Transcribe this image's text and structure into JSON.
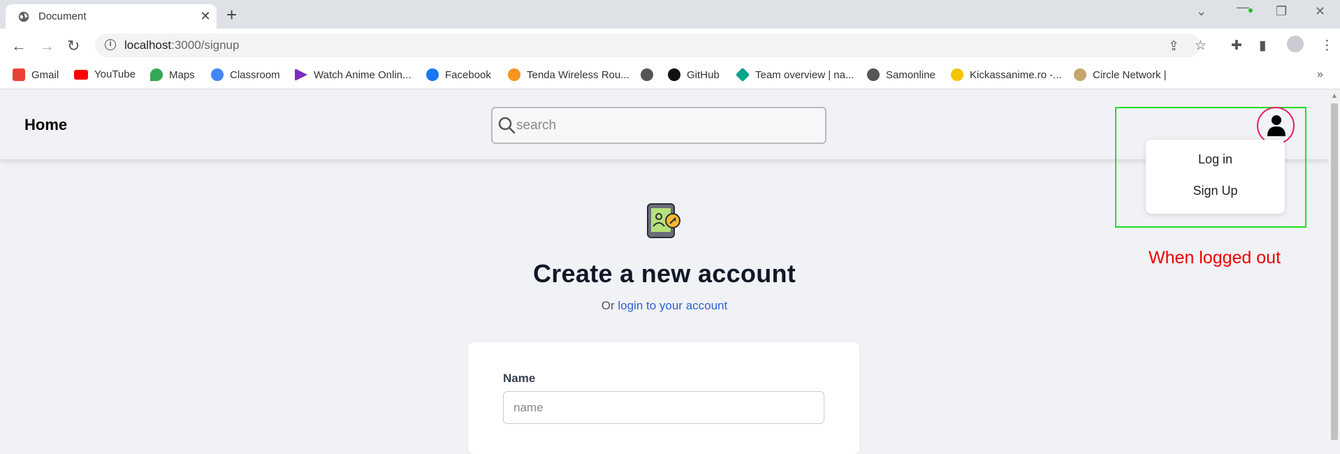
{
  "browser": {
    "tab_title": "Document",
    "url_host": "localhost",
    "url_path": ":3000/signup",
    "bookmarks": [
      {
        "label": "Gmail",
        "color": "#ea4335"
      },
      {
        "label": "YouTube",
        "color": "#ff0000"
      },
      {
        "label": "Maps",
        "color": "#34a853"
      },
      {
        "label": "Classroom",
        "color": "#4285f4"
      },
      {
        "label": "Watch Anime Onlin...",
        "color": "#7b2cbf"
      },
      {
        "label": "Facebook",
        "color": "#1877f2"
      },
      {
        "label": "Tenda Wireless Rou...",
        "color": "#f7931e"
      },
      {
        "label": "",
        "color": "#555555"
      },
      {
        "label": "GitHub",
        "color": "#111111"
      },
      {
        "label": "Team overview | na...",
        "color": "#0aa38b"
      },
      {
        "label": "Samonline",
        "color": "#555555"
      },
      {
        "label": "Kickassanime.ro -...",
        "color": "#f5c400"
      },
      {
        "label": "Circle Network |",
        "color": "#c8a46e"
      }
    ]
  },
  "app": {
    "home_label": "Home",
    "search_placeholder": "search",
    "menu": {
      "login": "Log in",
      "signup": "Sign Up"
    },
    "note": "When logged out",
    "signup": {
      "title": "Create a new account",
      "or_text": "Or ",
      "login_link": "login to your account",
      "name_label": "Name",
      "name_placeholder": "name"
    }
  },
  "colors": {
    "highlight_box": "#22dd22",
    "avatar_ring": "#e91e63",
    "note": "#ee0000",
    "link": "#2f5fd0"
  }
}
